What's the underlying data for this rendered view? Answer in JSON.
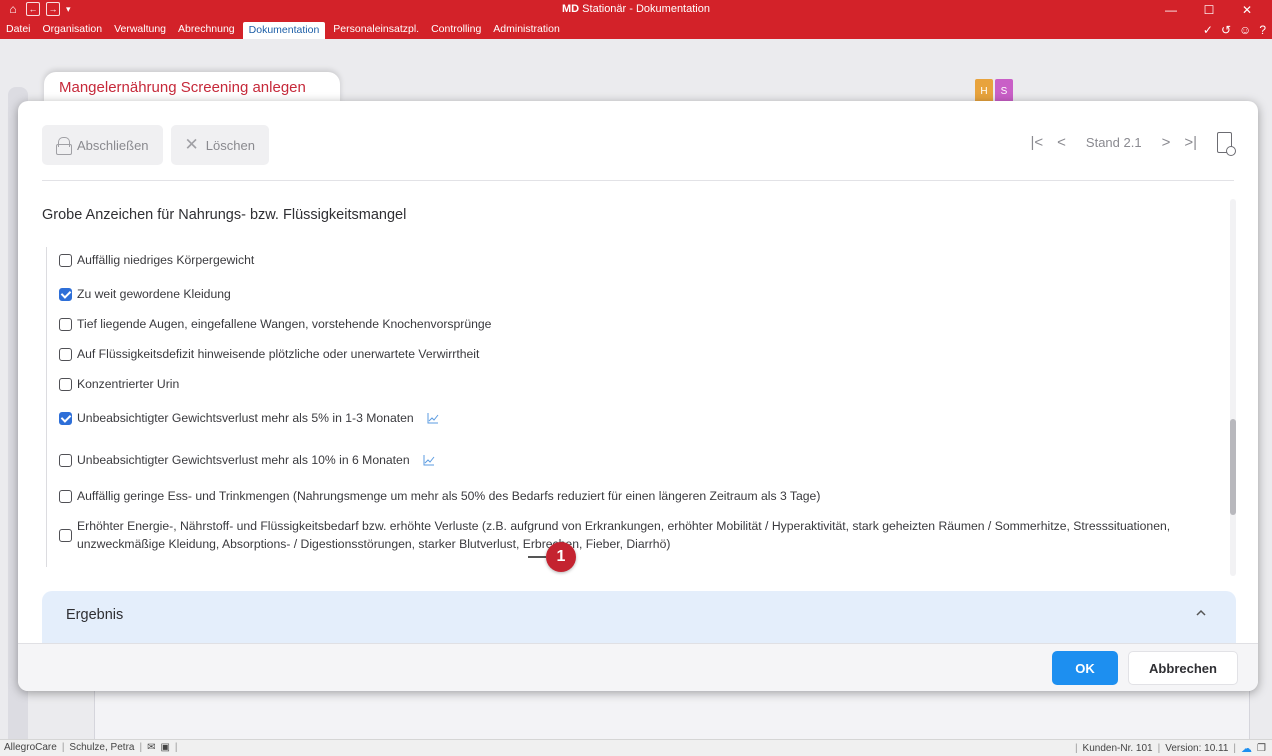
{
  "window": {
    "title_brand": "MD",
    "title_rest": " Stationär - Dokumentation"
  },
  "menu": {
    "items": [
      {
        "label": "Datei"
      },
      {
        "label": "Organisation"
      },
      {
        "label": "Verwaltung"
      },
      {
        "label": "Abrechnung"
      },
      {
        "label": "Dokumentation",
        "active": true
      },
      {
        "label": "Personaleinsatzpl."
      },
      {
        "label": "Controlling"
      },
      {
        "label": "Administration"
      }
    ]
  },
  "background": {
    "tabs": [
      {
        "label": "H",
        "color": "#e8a33d"
      },
      {
        "label": "S",
        "color": "#c95fc7"
      }
    ]
  },
  "dialog": {
    "tab_title": "Mangelernährung Screening anlegen",
    "toolbar": {
      "finish_label": "Abschließen",
      "delete_label": "Löschen"
    },
    "nav": {
      "first": "|<",
      "prev": "<",
      "stand": "Stand 2.1",
      "next": ">",
      "last": ">|"
    },
    "section_title": "Grobe Anzeichen für Nahrungs- bzw. Flüssigkeitsmangel",
    "items": [
      {
        "label": "Auffällig niedriges Körpergewicht",
        "checked": false,
        "chart": false
      },
      {
        "label": "Zu weit gewordene Kleidung",
        "checked": true,
        "chart": false
      },
      {
        "label": "Tief liegende Augen, eingefallene Wangen, vorstehende Knochenvorsprünge",
        "checked": false,
        "chart": false
      },
      {
        "label": "Auf Flüssigkeitsdefizit hinweisende plötzliche oder unerwartete Verwirrtheit",
        "checked": false,
        "chart": false
      },
      {
        "label": "Konzentrierter Urin",
        "checked": false,
        "chart": false
      },
      {
        "label": "Unbeabsichtigter Gewichtsverlust mehr als 5% in 1-3 Monaten",
        "checked": true,
        "chart": true
      },
      {
        "label": "Unbeabsichtigter Gewichtsverlust mehr als 10% in 6 Monaten",
        "checked": false,
        "chart": true
      },
      {
        "label": "Auffällig geringe Ess- und Trinkmengen (Nahrungsmenge um mehr als 50% des Bedarfs reduziert für einen längeren Zeitraum als 3 Tage)",
        "checked": false,
        "chart": false
      },
      {
        "label": "Erhöhter Energie-, Nährstoff- und Flüssigkeitsbedarf bzw. erhöhte Verluste (z.B. aufgrund von Erkrankungen, erhöhter Mobilität / Hyperaktivität, stark geheizten Räumen / Sommerhitze, Stresssituationen, unzweckmäßige Kleidung, Absorptions- / Digestionsstörungen, starker Blutverlust, Erbrechen, Fieber, Diarrhö)",
        "checked": false,
        "chart": false
      }
    ],
    "callout_number": "1",
    "result_title": "Ergebnis",
    "ok_label": "OK",
    "cancel_label": "Abbrechen"
  },
  "statusbar": {
    "product": "AllegroCare",
    "user": "Schulze, Petra",
    "customer": "Kunden-Nr. 101",
    "version": "Version: 10.11"
  }
}
